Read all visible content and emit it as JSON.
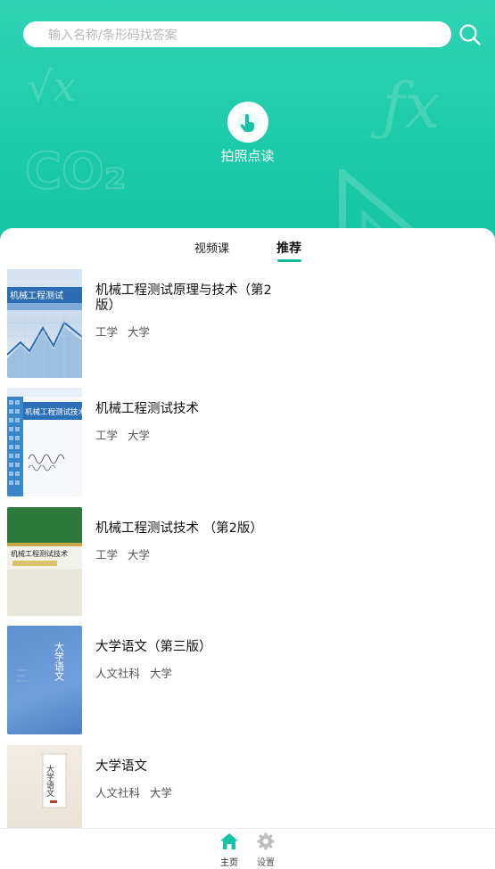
{
  "search": {
    "placeholder": "输入名称/条形码找答案"
  },
  "scan": {
    "label": "拍照点读"
  },
  "tabs": [
    {
      "label": "视频课",
      "active": false
    },
    {
      "label": "推荐",
      "active": true
    }
  ],
  "books": [
    {
      "title": "机械工程测试原理与技术（第2版）",
      "tags": [
        "工学",
        "大学"
      ],
      "cover_title": "机械工程测试原理与技术"
    },
    {
      "title": "机械工程测试技术",
      "tags": [
        "工学",
        "大学"
      ],
      "cover_title": "机械工程测试技术"
    },
    {
      "title": "机械工程测试技术 （第2版）",
      "tags": [
        "工学",
        "大学"
      ],
      "cover_title": "机械工程测试技术"
    },
    {
      "title": "大学语文（第三版）",
      "tags": [
        "人文社科",
        "大学"
      ],
      "cover_title": "大学语文"
    },
    {
      "title": "大学语文",
      "tags": [
        "人文社科",
        "大学"
      ],
      "cover_title": "大学语文"
    }
  ],
  "tabbar": {
    "home": "主页",
    "settings": "设置"
  },
  "colors": {
    "accent": "#16c3a4",
    "tab_active_underline": "#16b89a"
  }
}
